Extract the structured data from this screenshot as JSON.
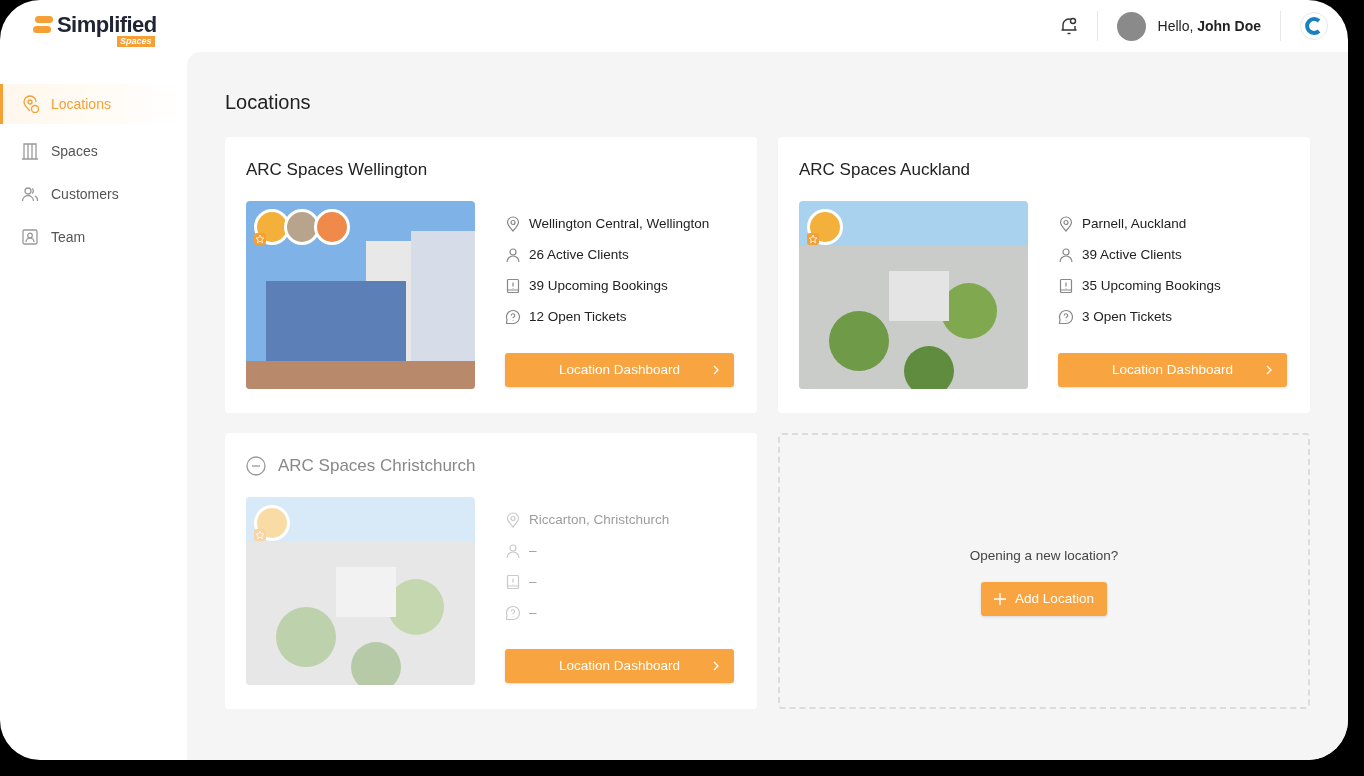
{
  "logo": {
    "wordmark": "Simplified",
    "badge": "Spaces"
  },
  "header": {
    "greeting": "Hello, **John Doe**"
  },
  "sidebar": {
    "items": [
      {
        "label": "Locations",
        "kind": "locations",
        "selected": true
      },
      {
        "label": "Spaces",
        "kind": "spaces",
        "selected": false
      },
      {
        "label": "Customers",
        "kind": "customers",
        "selected": false
      },
      {
        "label": "Team",
        "kind": "team",
        "selected": false
      }
    ]
  },
  "page_title": "Locations",
  "locations": [
    {
      "name": "ARC Spaces Wellington",
      "inactive": false,
      "avatars": [
        {
          "owner": true
        },
        {
          "owner": false
        },
        {
          "owner": false
        }
      ],
      "stats": [
        {
          "kind": "address",
          "text": "Wellington Central, Wellington"
        },
        {
          "kind": "clients",
          "text": "26 Active Clients"
        },
        {
          "kind": "bookings",
          "text": "39 Upcoming Bookings"
        },
        {
          "kind": "tickets",
          "text": "12 Open Tickets"
        }
      ],
      "button": "Location Dashboard"
    },
    {
      "name": "ARC Spaces Auckland",
      "inactive": false,
      "avatars": [
        {
          "owner": true
        }
      ],
      "stats": [
        {
          "kind": "address",
          "text": "Parnell, Auckland"
        },
        {
          "kind": "clients",
          "text": "39 Active Clients"
        },
        {
          "kind": "bookings",
          "text": "35 Upcoming Bookings"
        },
        {
          "kind": "tickets",
          "text": "3 Open Tickets"
        }
      ],
      "button": "Location Dashboard"
    },
    {
      "name": "ARC Spaces Christchurch",
      "inactive": true,
      "avatars": [
        {
          "owner": true
        }
      ],
      "stats": [
        {
          "kind": "address",
          "text": "Riccarton, Christchurch"
        },
        {
          "kind": "clients",
          "text": "–"
        },
        {
          "kind": "bookings",
          "text": "–"
        },
        {
          "kind": "tickets",
          "text": "–"
        }
      ],
      "button": "Location Dashboard"
    }
  ],
  "add_card": {
    "prompt": "Opening a new location?",
    "button": "Add Location"
  }
}
